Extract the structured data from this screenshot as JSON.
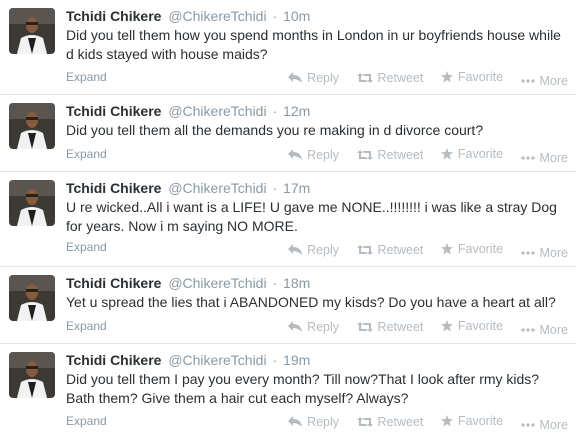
{
  "actions": {
    "reply": "Reply",
    "retweet": "Retweet",
    "favorite": "Favorite",
    "more": "More",
    "expand": "Expand"
  },
  "tweets": [
    {
      "name": "Tchidi Chikere",
      "handle": "@ChikereTchidi",
      "time": "10m",
      "text": "Did you tell them how you spend months in London in ur boyfriends house while d kids stayed with house maids?"
    },
    {
      "name": "Tchidi Chikere",
      "handle": "@ChikereTchidi",
      "time": "12m",
      "text": "Did you tell them all the demands you re making in d divorce court?"
    },
    {
      "name": "Tchidi Chikere",
      "handle": "@ChikereTchidi",
      "time": "17m",
      "text": "U re wicked..All i want is a LIFE! U gave me NONE..!!!!!!!! i was like a stray Dog for years. Now i m saying NO MORE."
    },
    {
      "name": "Tchidi Chikere",
      "handle": "@ChikereTchidi",
      "time": "18m",
      "text": "Yet u spread the lies that i ABANDONED my kisds? Do you have a heart at all?"
    },
    {
      "name": "Tchidi Chikere",
      "handle": "@ChikereTchidi",
      "time": "19m",
      "text": "Did you tell them I pay you every month?  Till now?That I look after rmy kids? Bath them? Give them a hair cut  each myself? Always?"
    }
  ]
}
